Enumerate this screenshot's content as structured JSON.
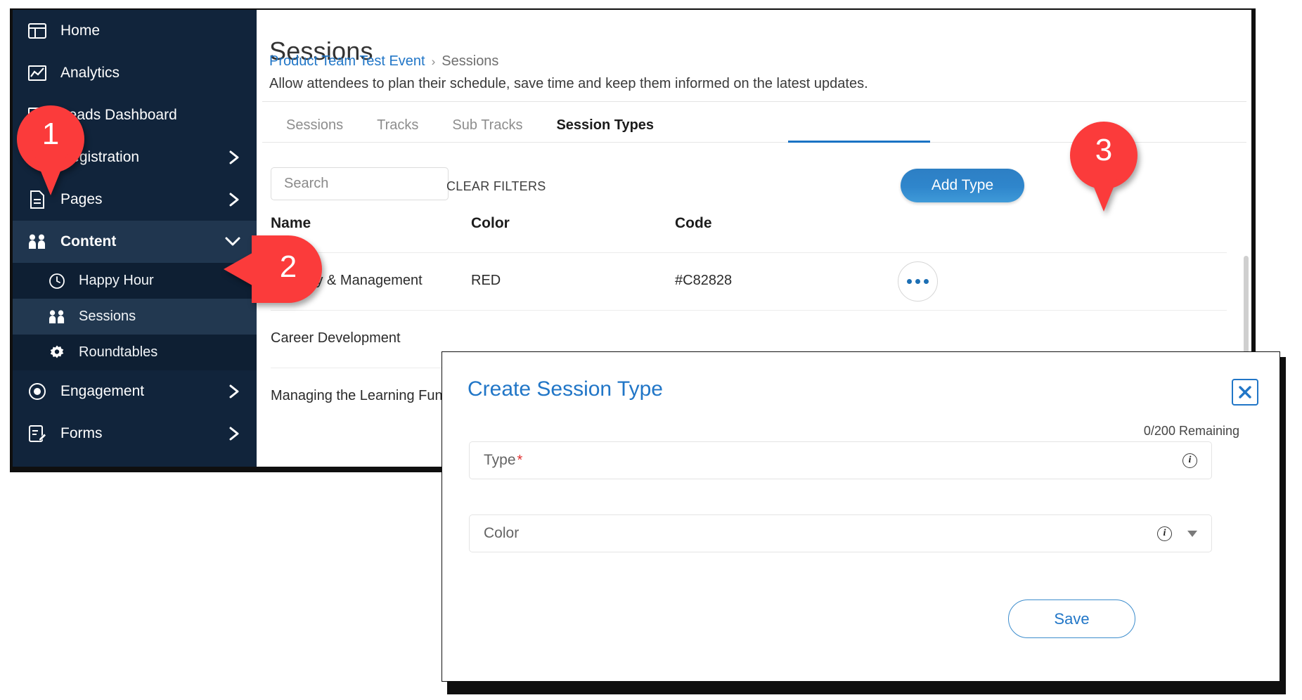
{
  "sidebar": {
    "items": [
      {
        "label": "Home",
        "icon": "home-dashboard-icon",
        "expandable": false
      },
      {
        "label": "Analytics",
        "icon": "chart-line-icon",
        "expandable": false
      },
      {
        "label": "Leads Dashboard",
        "icon": "chart-line-icon",
        "expandable": false
      },
      {
        "label": "Registration",
        "icon": "people-group-icon",
        "expandable": true
      },
      {
        "label": "Pages",
        "icon": "document-icon",
        "expandable": true
      },
      {
        "label": "Content",
        "icon": "people-icon",
        "expandable": true,
        "expanded": true
      },
      {
        "label": "Engagement",
        "icon": "target-circle-icon",
        "expandable": true
      },
      {
        "label": "Forms",
        "icon": "form-edit-icon",
        "expandable": true
      }
    ],
    "content_children": [
      {
        "label": "Happy Hour",
        "icon": "clock-icon",
        "selected": false
      },
      {
        "label": "Sessions",
        "icon": "people-icon",
        "selected": true
      },
      {
        "label": "Roundtables",
        "icon": "gear-icon",
        "selected": false
      }
    ]
  },
  "header": {
    "title": "Sessions",
    "breadcrumb_root": "Product Team Test Event",
    "breadcrumb_separator": "›",
    "breadcrumb_current": "Sessions",
    "description": "Allow attendees to plan their schedule, save time and keep them informed on the latest updates."
  },
  "tabs": [
    {
      "label": "Sessions",
      "active": false
    },
    {
      "label": "Tracks",
      "active": false
    },
    {
      "label": "Sub Tracks",
      "active": false
    },
    {
      "label": "Session Types",
      "active": true
    }
  ],
  "toolbar": {
    "search_placeholder": "Search",
    "search_value": "",
    "clear_filters_label": "CLEAR FILTERS",
    "add_type_label": "Add Type"
  },
  "table": {
    "columns": [
      "Name",
      "Color",
      "Code"
    ],
    "rows": [
      {
        "name": "Strategy & Management",
        "color": "RED",
        "code": "#C82828",
        "has_menu": true
      },
      {
        "name": "Career Development",
        "color": "",
        "code": "",
        "has_menu": false
      },
      {
        "name": "Managing the Learning Function",
        "color": "",
        "code": "",
        "has_menu": false
      }
    ]
  },
  "modal": {
    "title": "Create Session Type",
    "close_label": "✕",
    "remaining_label": "0/200 Remaining",
    "type_field": {
      "label": "Type",
      "required_marker": "*",
      "value": "",
      "info_glyph": "i"
    },
    "color_field": {
      "label": "Color",
      "value": "",
      "info_glyph": "i"
    },
    "save_label": "Save"
  },
  "annotations": [
    {
      "number": "1",
      "target": "sidebar-content-area"
    },
    {
      "number": "2",
      "target": "sidebar-item-sessions"
    },
    {
      "number": "3",
      "target": "add-type-button"
    }
  ],
  "colors": {
    "sidebar_bg": "#11243b",
    "accent_blue": "#2176c7",
    "pin_red": "#fb3b3b",
    "row_red_code": "#C82828"
  }
}
